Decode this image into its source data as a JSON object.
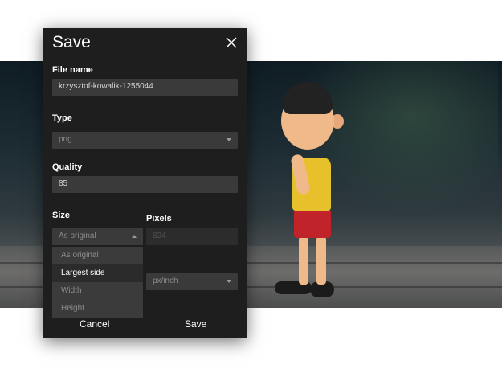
{
  "dialog": {
    "title": "Save",
    "file_name_label": "File name",
    "file_name_value": "krzysztof-kowalik-1255044",
    "type_label": "Type",
    "type_value": "png",
    "quality_label": "Quality",
    "quality_value": "85",
    "size_label": "Size",
    "size_value": "As original",
    "size_options": [
      "As original",
      "Largest side",
      "Width",
      "Height"
    ],
    "size_highlighted_option": "Largest side",
    "pixels_label": "Pixels",
    "pixels_value": "824",
    "unit_value": "px/inch",
    "cancel_label": "Cancel",
    "save_label": "Save"
  },
  "colors": {
    "dialog_bg": "#1e1e1e",
    "field_bg": "#3a3a3a",
    "text": "#ffffff"
  }
}
